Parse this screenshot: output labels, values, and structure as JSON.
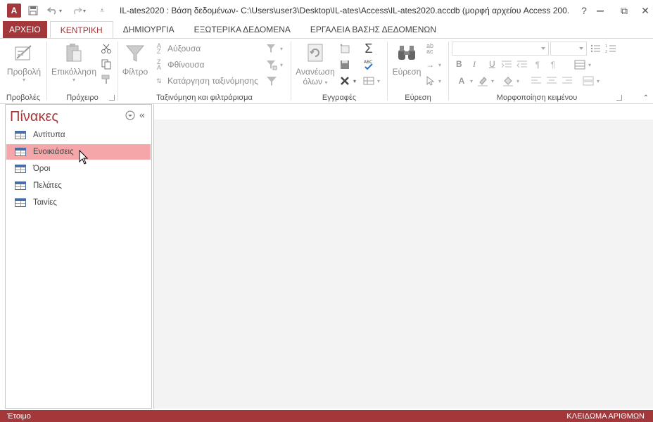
{
  "titlebar": {
    "title": "IL-ates2020 : Βάση δεδομένων- C:\\Users\\user3\\Desktop\\IL-ates\\Access\\IL-ates2020.accdb (μορφή αρχείου Access 200...",
    "app_icon": "A",
    "help": "?",
    "restore": "⧉",
    "close": "✕"
  },
  "tabs": [
    {
      "label": "ΑΡΧΕΙΟ"
    },
    {
      "label": "ΚΕΝΤΡΙΚΗ"
    },
    {
      "label": "ΔΗΜΙΟΥΡΓΙΑ"
    },
    {
      "label": "ΕΞΩΤΕΡΙΚΑ ΔΕΔΟΜΕΝΑ"
    },
    {
      "label": "ΕΡΓΑΛΕΙΑ ΒΑΣΗΣ ΔΕΔΟΜΕΝΩΝ"
    }
  ],
  "ribbon": {
    "views": {
      "group": "Προβολές",
      "view_label": "Προβολή"
    },
    "clipboard": {
      "group": "Πρόχειρο",
      "paste_label": "Επικόλληση"
    },
    "sort_filter": {
      "group": "Ταξινόμηση και φιλτράρισμα",
      "filter_label": "Φίλτρο",
      "ascending": "Αύξουσα",
      "descending": "Φθίνουσα",
      "remove_sort": "Κατάργηση ταξινόμησης"
    },
    "records": {
      "group": "Εγγραφές",
      "refresh_line1": "Ανανέωση",
      "refresh_line2": "όλων"
    },
    "find": {
      "group": "Εύρεση",
      "find_label": "Εύρεση"
    },
    "text_format": {
      "group": "Μορφοποίηση κειμένου",
      "bold": "B",
      "italic": "I",
      "underline": "U"
    }
  },
  "nav": {
    "title": "Πίνακες",
    "items": [
      {
        "label": "Αντίτυπα"
      },
      {
        "label": "Ενοικιάσεις"
      },
      {
        "label": "Όροι"
      },
      {
        "label": "Πελάτες"
      },
      {
        "label": "Ταινίες"
      }
    ],
    "selected_index": 1
  },
  "status": {
    "left": "Έτοιμο",
    "right": "ΚΛΕΙΔΩΜΑ ΑΡΙΘΜΩΝ"
  },
  "colors": {
    "accent": "#a4373a",
    "selected_item": "#f4a6a8"
  }
}
